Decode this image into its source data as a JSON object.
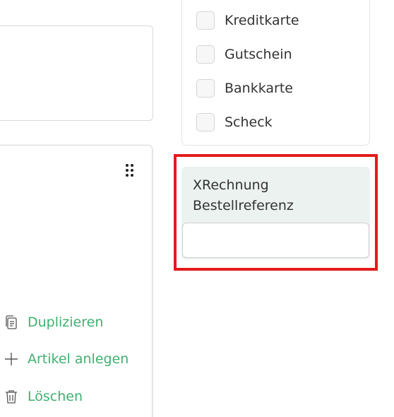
{
  "payment_methods": [
    {
      "label": "Kreditkarte",
      "checked": false
    },
    {
      "label": "Gutschein",
      "checked": false
    },
    {
      "label": "Bankkarte",
      "checked": false
    },
    {
      "label": "Scheck",
      "checked": false
    }
  ],
  "item_actions": [
    {
      "label": "Duplizieren",
      "icon": "duplicate-icon"
    },
    {
      "label": "Artikel anlegen",
      "icon": "plus-icon"
    },
    {
      "label": "Löschen",
      "icon": "trash-icon"
    }
  ],
  "xrechnung": {
    "label_line1": "XRechnung",
    "label_line2": "Bestellreferenz",
    "value": ""
  },
  "colors": {
    "accent": "#3fb071",
    "highlight": "#e41b1b",
    "panel": "#ecf2ef"
  }
}
